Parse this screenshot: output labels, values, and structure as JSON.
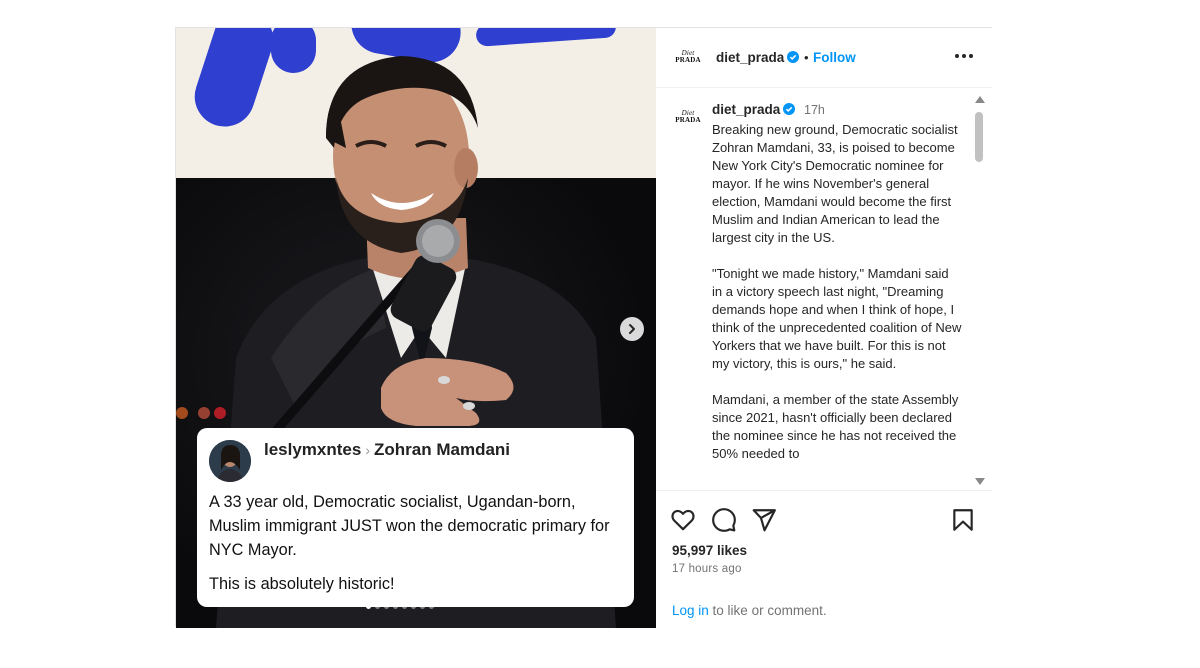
{
  "header": {
    "username": "diet_prada",
    "follow_label": "Follow",
    "separator": "•",
    "more_label": "•••",
    "logo_text_top": "Diet",
    "logo_text_bottom": "PRADA"
  },
  "caption": {
    "username": "diet_prada",
    "time": "17h",
    "paragraphs": [
      "Breaking new ground, Democratic socialist Zohran Mamdani, 33, is poised to become New York City's Democratic nominee for mayor. If he wins November's general election, Mamdani would become the first Muslim and Indian American to lead the largest city in the US.",
      "\"Tonight we made history,\" Mamdani said in a victory speech last night, \"Dreaming demands hope and when I think of hope, I think of the unprecedented coalition of New Yorkers that we have built. For this is not my victory, this is ours,\" he said.",
      "Mamdani, a member of the state Assembly since 2021, hasn't officially been declared the nominee since he has not received the 50% needed to"
    ]
  },
  "quote_card": {
    "username": "leslymxntes",
    "arrow": "›",
    "target": "Zohran Mamdani",
    "text1": "A 33 year old, Democratic socialist, Ugandan-born, Muslim immigrant JUST won the democratic primary for NYC Mayor.",
    "text2": "This is absolutely historic!"
  },
  "engagement": {
    "likes": "95,997 likes",
    "time_ago": "17 hours ago",
    "login_link": "Log in",
    "login_suffix": " to like or comment."
  },
  "colors": {
    "accent": "#0095f6",
    "banner_blue": "#2f3fd0",
    "verified_blue": "#0095f6"
  },
  "carousel": {
    "slides": 8,
    "active_slide": 1
  }
}
